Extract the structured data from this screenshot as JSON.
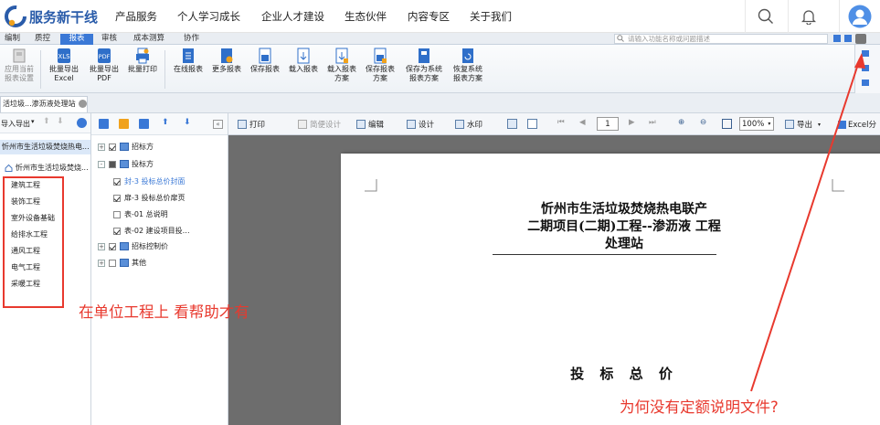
{
  "brand": {
    "name": "服务新干线",
    "colors": {
      "blue": "#2a5caa",
      "accent": "#f0a21d",
      "annotation": "#e8392e",
      "active_tab": "#3a78d6"
    }
  },
  "topnav": {
    "items": [
      "产品服务",
      "个人学习成长",
      "企业人才建设",
      "生态伙伴",
      "内容专区",
      "关于我们"
    ],
    "icons": [
      "search-icon",
      "bell-icon",
      "avatar-icon"
    ]
  },
  "menu_tabs": {
    "items": [
      "编制",
      "质控",
      "报表",
      "审核",
      "成本测算",
      "协作"
    ],
    "active_index": 2,
    "search_placeholder": "请输入功能名称或问题描述"
  },
  "ribbon": {
    "buttons": [
      {
        "line1": "应用当前",
        "line2": "报表设置",
        "icon": "apply-settings-icon",
        "disabled": true
      },
      {
        "line1": "批量导出",
        "line2": "Excel",
        "icon": "excel-export-icon"
      },
      {
        "line1": "批量导出",
        "line2": "PDF",
        "icon": "pdf-export-icon"
      },
      {
        "line1": "批量打印",
        "line2": "",
        "icon": "batch-print-icon"
      },
      {
        "line1": "在线报表",
        "line2": "",
        "icon": "online-report-icon"
      },
      {
        "line1": "更多报表",
        "line2": "",
        "icon": "more-reports-icon"
      },
      {
        "line1": "保存报表",
        "line2": "",
        "icon": "save-report-icon"
      },
      {
        "line1": "载入报表",
        "line2": "",
        "icon": "load-report-icon"
      },
      {
        "line1": "载入报表",
        "line2": "方案",
        "icon": "load-scheme-icon"
      },
      {
        "line1": "保存报表",
        "line2": "方案",
        "icon": "save-scheme-icon"
      },
      {
        "line1": "保存为系统",
        "line2": "报表方案",
        "icon": "save-system-scheme-icon"
      },
      {
        "line1": "恢复系统",
        "line2": "报表方案",
        "icon": "restore-scheme-icon"
      }
    ]
  },
  "doc_tab": {
    "label": "活垃圾...渗沥液处理站"
  },
  "left_pane": {
    "toolbar_label": "导入导出",
    "selected_node": "忻州市生活垃圾焚烧热电...",
    "child_node": "忻州市生活垃圾焚烧...",
    "units": [
      "建筑工程",
      "装饰工程",
      "室外设备基础",
      "给排水工程",
      "通风工程",
      "电气工程",
      "采暖工程"
    ]
  },
  "mid_tree": {
    "nodes": [
      {
        "label": "招标方",
        "checked": true,
        "expand": "+"
      },
      {
        "label": "投标方",
        "checked": "partial",
        "expand": "-"
      },
      {
        "label": "封-3  投标总价封面",
        "checked": true,
        "selected": true
      },
      {
        "label": "扉-3  投标总价扉页",
        "checked": true
      },
      {
        "label": "表-01  总说明",
        "checked": false
      },
      {
        "label": "表-02  建设项目投…",
        "checked": true
      },
      {
        "label": "招标控制价",
        "checked": true,
        "expand": "+"
      },
      {
        "label": "其他",
        "checked": false,
        "expand": "+"
      }
    ]
  },
  "report_toolbar": {
    "print": "打印",
    "simple_design": "简便设计",
    "edit": "编辑",
    "design": "设计",
    "watermark": "水印",
    "page": "1",
    "zoom": "100%",
    "export": "导出",
    "excel_split": "Excel分"
  },
  "report": {
    "title_lines": [
      "忻州市生活垃圾焚烧热电联产",
      "二期项目(二期)工程--渗沥液 工程",
      "处理站"
    ],
    "subtitle": "投 标 总 价"
  },
  "annotations": {
    "note1": "在单位工程上 看帮助才有",
    "note2": "为何没有定额说明文件?"
  }
}
